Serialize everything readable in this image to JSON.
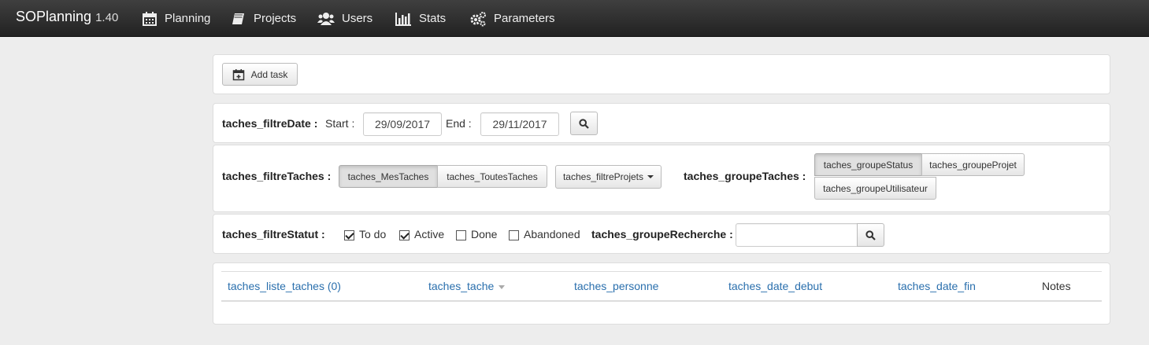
{
  "app": {
    "name": "SOPlanning",
    "version": "1.40"
  },
  "nav": [
    {
      "label": "Planning",
      "icon": "calendar-icon"
    },
    {
      "label": "Projects",
      "icon": "book-icon"
    },
    {
      "label": "Users",
      "icon": "users-icon"
    },
    {
      "label": "Stats",
      "icon": "bar-chart-icon"
    },
    {
      "label": "Parameters",
      "icon": "cogs-icon"
    }
  ],
  "toolbar": {
    "add_task_label": "Add task"
  },
  "date_filter": {
    "label": "taches_filtreDate :",
    "start_label": "Start :",
    "start_value": "29/09/2017",
    "end_label": "End :",
    "end_value": "29/11/2017"
  },
  "task_filter": {
    "label": "taches_filtreTaches :",
    "mine_label": "taches_MesTaches",
    "all_label": "taches_ToutesTaches",
    "projects_label": "taches_filtreProjets",
    "group_label": "taches_groupeTaches :",
    "group_status": "taches_groupeStatus",
    "group_project": "taches_groupeProjet",
    "group_user": "taches_groupeUtilisateur"
  },
  "status_filter": {
    "label": "taches_filtreStatut :",
    "options": [
      {
        "label": "To do",
        "checked": true
      },
      {
        "label": "Active",
        "checked": true
      },
      {
        "label": "Done",
        "checked": false
      },
      {
        "label": "Abandoned",
        "checked": false
      }
    ],
    "search_label": "taches_groupeRecherche :",
    "search_value": ""
  },
  "table": {
    "columns": [
      "taches_liste_taches (0)",
      "taches_tache",
      "taches_personne",
      "taches_date_debut",
      "taches_date_fin",
      "Notes"
    ]
  }
}
